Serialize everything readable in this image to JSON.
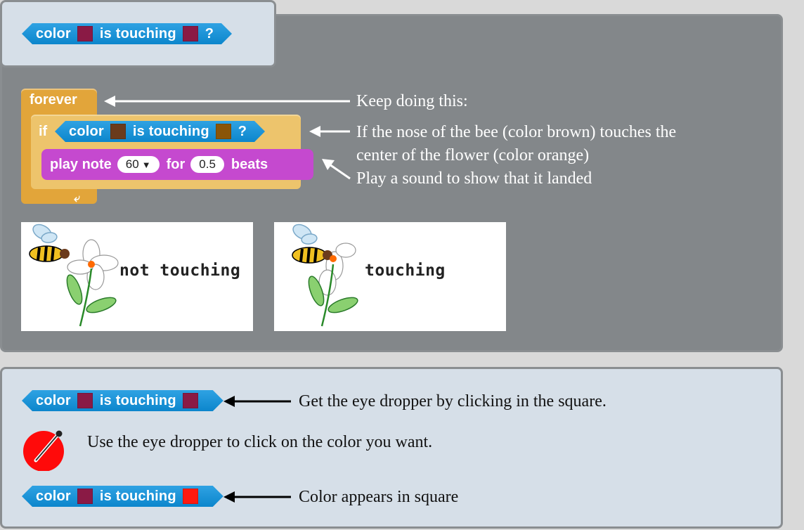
{
  "header_block": {
    "color_word": "color",
    "touching_word": "is touching",
    "question_mark": "?",
    "swatch1": "#8a1a45",
    "swatch2": "#8a1a45"
  },
  "script": {
    "forever_label": "forever",
    "if_label": "if",
    "condition": {
      "color_word": "color",
      "touching_word": "is touching",
      "question_mark": "?",
      "swatch1": "#6b3b1c",
      "swatch2": "#8a5508"
    },
    "play_note": {
      "play_label": "play note",
      "note_value": "60",
      "for_label": "for",
      "beats_value": "0.5",
      "beats_label": "beats"
    }
  },
  "annotations": {
    "keep_doing": "Keep doing this:",
    "if_line1": "If the nose of the bee (color brown) touches the",
    "if_line2": "center of the flower (color orange)",
    "play_sound": "Play a sound to show that it landed"
  },
  "images": {
    "caption_not_touching": "not touching",
    "caption_touching": "touching"
  },
  "instructions": {
    "block1": {
      "color_word": "color",
      "touching_word": "is touching",
      "swatch1": "#8a1a45",
      "swatch2": "#8a1a45"
    },
    "step1": "Get the eye dropper by clicking in the square.",
    "step2": "Use the eye dropper to click on the color you want.",
    "block2": {
      "color_word": "color",
      "touching_word": "is touching",
      "swatch1": "#8a1a45",
      "swatch2": "#ff1a10"
    },
    "step3": "Color appears in square"
  },
  "colors": {
    "sensing_blue": "#0c86cc",
    "control_orange": "#e2a53a",
    "sound_purple": "#c549cf",
    "dropper_red": "#ff0a0a"
  },
  "icons": [
    "eyedropper-icon",
    "arrow-left-icon",
    "dropdown-arrow-icon",
    "loop-arrow-icon"
  ]
}
